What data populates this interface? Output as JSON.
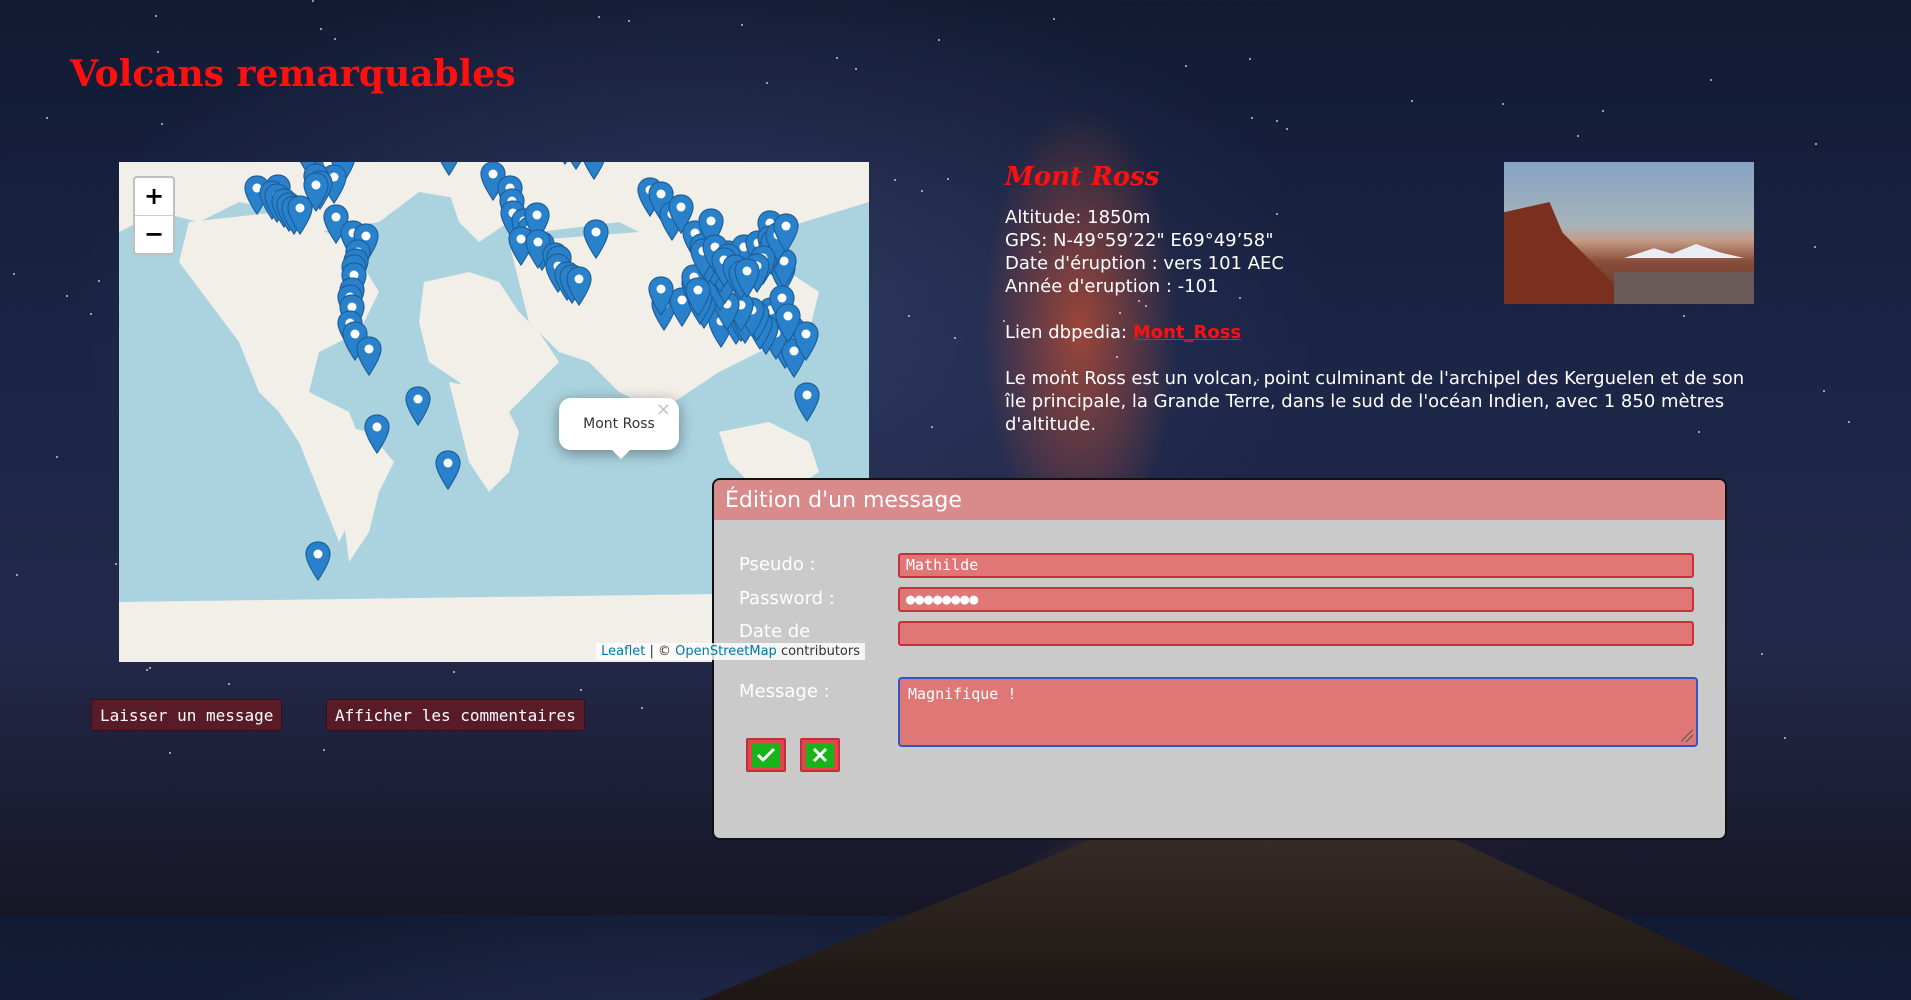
{
  "page": {
    "title": "Volcans remarquables"
  },
  "map": {
    "zoom_in": "+",
    "zoom_out": "−",
    "popup": {
      "text": "Mont Ross",
      "close": "×"
    },
    "attribution": {
      "leaflet": "Leaflet",
      "sep": " | © ",
      "osm": "OpenStreetMap",
      "suffix": " contributors"
    }
  },
  "buttons": {
    "leave_message": "Laisser un message",
    "show_comments": "Afficher les commentaires"
  },
  "volcano": {
    "name": "Mont Ross",
    "altitude": "Altitude: 1850m",
    "gps": "GPS: N-49°59’22\"  E69°49’58\"",
    "eruption_date": "Date d'éruption : vers 101 AEC",
    "eruption_year": "Année d'eruption : -101",
    "dbpedia_label": "Lien dbpedia: ",
    "dbpedia_link": "Mont_Ross",
    "description": "Le mont Ross est un volcan, point culminant de l'archipel des Kerguelen et de son île principale, la Grande Terre, dans le sud de l'océan Indien, avec 1 850 mètres d'altitude."
  },
  "dialog": {
    "title": "Édition d'un message",
    "pseudo_label": "Pseudo :",
    "pseudo_value": "Mathilde",
    "password_label": "Password :",
    "password_value": "●●●●●●●●",
    "date_label": "Date de",
    "date_value": "",
    "message_label": "Message :",
    "message_value": "Magnifique !",
    "confirm_icon": "check-icon",
    "cancel_icon": "close-icon"
  },
  "colors": {
    "title_red": "#ff1010",
    "map_water": "#aad3df",
    "marker_blue": "#2a81cb",
    "dialog_bg": "#cacaca",
    "dialog_header": "#d98a8a"
  }
}
